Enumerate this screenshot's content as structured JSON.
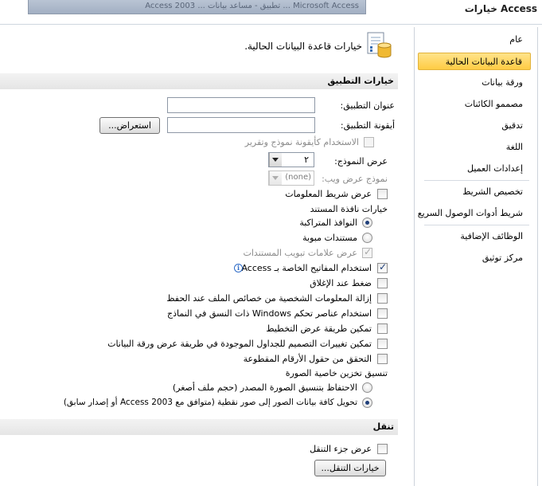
{
  "window": {
    "ghost_title": "Microsoft Access  ...  تطبيق - مساعد بيانات ...  Access 2003",
    "title": "خيارات Access"
  },
  "sidebar": {
    "items": [
      {
        "label": "عام"
      },
      {
        "label": "قاعدة البيانات الحالية",
        "selected": true
      },
      {
        "label": "ورقة بيانات"
      },
      {
        "label": "مصممو الكائنات"
      },
      {
        "label": "تدقيق"
      },
      {
        "label": "اللغة"
      },
      {
        "label": "إعدادات العميل"
      },
      {
        "label": "تخصيص الشريط"
      },
      {
        "label": "شريط أدوات الوصول السريع"
      },
      {
        "label": "الوظائف الإضافية"
      },
      {
        "label": "مركز توثيق"
      }
    ]
  },
  "header": {
    "title": "خيارات قاعدة البيانات الحالية.",
    "icon": "database-options-icon"
  },
  "app_options": {
    "section_title": "خيارات التطبيق",
    "app_title_label": "عنوان التطبيق:",
    "app_title_value": "",
    "app_icon_label": "أيقونة التطبيق:",
    "app_icon_value": "",
    "browse_label": "استعراض...",
    "use_as_form_icon_label": "الاستخدام كأيقونة نموذج وتقرير",
    "display_form_label": "عرض النموذج:",
    "display_form_value": "٢",
    "web_display_form_label": "نموذج عرض ويب:",
    "web_display_form_value": "(none)",
    "status_bar_label": "عرض شريط المعلومات",
    "doc_window_options_label": "خيارات نافذة المستند",
    "overlapping_windows_label": "النوافذ المتراكبة",
    "tabbed_documents_label": "مستندات مبوبة",
    "doc_tabs_label": "عرض علامات تبويب المستندات",
    "use_access_keys_label": "استخدام المفاتيح الخاصة بـ Access",
    "compact_on_close_label": "ضغط عند الإغلاق",
    "remove_personal_info_label": "إزالة المعلومات الشخصية من خصائص الملف عند الحفظ",
    "use_windows_themed_label": "استخدام عناصر تحكم Windows ذات النسق في النماذج",
    "enable_layout_view_label": "تمكين طريقة عرض التخطيط",
    "enable_design_changes_label": "تمكين تغييرات التصميم للجداول الموجودة في طريقة عرض ورقة البيانات",
    "check_truncated_label": "التحقق من حقول الأرقام المقطوعة",
    "picture_storage_label": "تنسيق تخزين خاصية الصورة",
    "preserve_format_label": "الاحتفاظ بتنسيق الصورة المصدر (حجم ملف أصغر)",
    "convert_bitmap_label": "تحويل كافة بيانات الصور إلى صور نقطية (متوافق مع Access 2003 أو إصدار سابق)"
  },
  "navigation": {
    "section_title": "تنقل",
    "display_nav_pane_label": "عرض جزء التنقل",
    "nav_options_button": "خيارات التنقل..."
  }
}
